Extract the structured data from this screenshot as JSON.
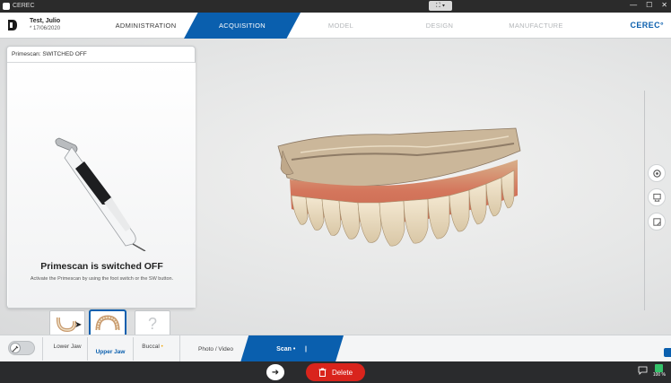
{
  "window": {
    "title": "CEREC",
    "controls": [
      "minimize",
      "maximize",
      "close"
    ]
  },
  "header": {
    "patient": {
      "name": "Test, Julio",
      "dob": "* 17/06/2020"
    },
    "phases": [
      {
        "label": "ADMINISTRATION",
        "state": "done"
      },
      {
        "label": "ACQUISITION",
        "state": "active"
      },
      {
        "label": "MODEL",
        "state": "disabled"
      },
      {
        "label": "DESIGN",
        "state": "disabled"
      },
      {
        "label": "MANUFACTURE",
        "state": "disabled"
      }
    ],
    "brand": "CEREC°"
  },
  "status_panel": {
    "title": "Primescan: SWITCHED OFF",
    "heading": "Primescan is switched OFF",
    "description": "Activate the Primescan by using the foot switch or the SW button."
  },
  "side_tools": [
    {
      "name": "settings-icon"
    },
    {
      "name": "scan-review-icon"
    },
    {
      "name": "window-icon"
    }
  ],
  "scan_catalog": {
    "items": [
      {
        "label": "Lower Jaw",
        "selected": false
      },
      {
        "label": "Upper Jaw",
        "selected": true
      },
      {
        "label": "Buccal",
        "selected": false
      }
    ],
    "buccal_marker": "•",
    "empty_thumb": "?"
  },
  "steps": {
    "photo_video": "Photo / Video",
    "scan": "Scan",
    "scan_marker": "•"
  },
  "footer": {
    "delete_label": "Delete",
    "battery": "100 %"
  },
  "colors": {
    "accent": "#0a5fae",
    "delete": "#d9241c",
    "footer": "#2a2b2d",
    "battery": "#34c26a"
  }
}
